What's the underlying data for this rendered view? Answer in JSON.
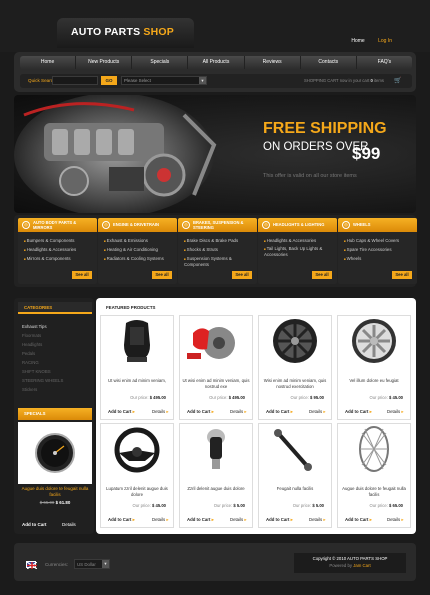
{
  "header": {
    "logo_main": "AUTO PARTS",
    "logo_accent": "SHOP",
    "home": "Home",
    "login": "Log In"
  },
  "nav": [
    "Home",
    "New Products",
    "Specials",
    "All Products",
    "Reviews",
    "Contacts",
    "FAQ's"
  ],
  "search": {
    "label": "Quick Search:",
    "button": "GO",
    "select": "Please Select",
    "select_arrow": "▼",
    "cart_prefix": "SHOPPING CART",
    "cart_mid": "now in your cart",
    "cart_count": "0",
    "cart_suffix": "items"
  },
  "banner": {
    "line1": "FREE SHIPPING",
    "line2": "ON ORDERS OVER",
    "price": "$99",
    "note": "This offer is valid on all our store items"
  },
  "categories": [
    {
      "title": "AUTO BODY PARTS & MIRRORS",
      "items": [
        "Bumpers & Components",
        "Headlights & Accessories",
        "Mirrors & Components"
      ]
    },
    {
      "title": "ENGINE & DRIVETRAIN",
      "items": [
        "Exhaust & Emissions",
        "Heating & Air Conditioning",
        "Radiators & Cooling Systems"
      ]
    },
    {
      "title": "BRAKES, SUSPENSION & STEERING",
      "items": [
        "Brake Discs & Brake Pads",
        "Shocks & Struts",
        "Suspension Systems & Components"
      ]
    },
    {
      "title": "HEADLIGHTS & LIGHTING",
      "items": [
        "Headlights & Accessories",
        "Tail Lights, Back Up Lights & Accessories"
      ]
    },
    {
      "title": "WHEELS",
      "items": [
        "Hub Caps & Wheel Covers",
        "Spare Tire Accessories",
        "Wheels"
      ]
    }
  ],
  "see_all": "See all",
  "sidebar": {
    "categories_title": "CATEGORIES",
    "items": [
      "Exhaust Tips",
      "Floormats",
      "Headlights",
      "Pedals",
      "RACING",
      "SHIFT KNOBS",
      "STEERING WHEELS",
      "Stickers"
    ],
    "specials_title": "SPECIALS",
    "special_name": "Augue duis dolore te feugait nulla facilis",
    "old_price": "$ 65.00",
    "new_price": "$ 61.80",
    "add": "Add to Cart",
    "details": "Details"
  },
  "main_title": "FEATURED PRODUCTS",
  "products": [
    {
      "name": "Ut wisi enim ad minim veniam,",
      "price": "$ 495.00"
    },
    {
      "name": "Ut wisi enim ad minim veniam, quis nostrud exe",
      "price": "$ 495.00"
    },
    {
      "name": "Wisi enim ad minim veniam, quis nostrud exercitation",
      "price": "$ 95.00"
    },
    {
      "name": "Vel illum dolore eu feugiat",
      "price": "$ 45.00"
    },
    {
      "name": "Lupatum zzril delenit augue duis dolore",
      "price": "$ 45.00"
    },
    {
      "name": "Zzril delenit augue duis dolore",
      "price": "$ 5.00"
    },
    {
      "name": "Feugait nulla facilis",
      "price": "$ 5.00"
    },
    {
      "name": "Augue duis dolore te feugait nulla facilis",
      "price": "$ 65.00"
    }
  ],
  "price_label": "Our price:",
  "add_to_cart": "Add to Cart",
  "details": "Details",
  "footer": {
    "currencies_label": "Currencies:",
    "currency": "US Dollar",
    "copyright": "Copyright © 2010 AUTO PARTS SHOP",
    "powered_by": "Powered by",
    "powered_link": "Jam Cart"
  },
  "colors": {
    "accent": "#f5a81a",
    "background": "#1b1b1b"
  }
}
